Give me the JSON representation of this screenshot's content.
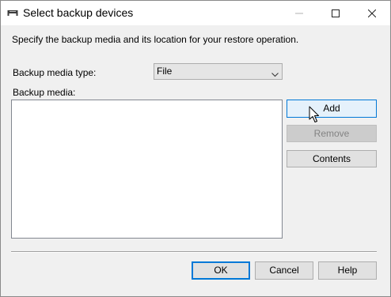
{
  "window": {
    "title": "Select backup devices",
    "icon": "backup-device-icon"
  },
  "titlebar_buttons": {
    "minimize": "minimize-icon",
    "maximize": "maximize-icon",
    "close": "close-icon"
  },
  "instruction": "Specify the backup media and its location for your restore operation.",
  "media_type": {
    "label": "Backup media type:",
    "selected": "File"
  },
  "media": {
    "label": "Backup media:",
    "items": []
  },
  "side_buttons": {
    "add": "Add",
    "remove": "Remove",
    "contents": "Contents"
  },
  "footer_buttons": {
    "ok": "OK",
    "cancel": "Cancel",
    "help": "Help"
  },
  "colors": {
    "accent": "#0078d7",
    "dialog_background": "#f0f0f0",
    "disabled_text": "#838383"
  }
}
